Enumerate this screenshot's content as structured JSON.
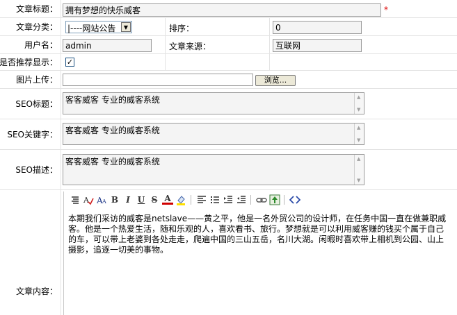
{
  "title_row": {
    "label": "文章标题：",
    "value": "拥有梦想的快乐威客",
    "required_mark": "*"
  },
  "category_row": {
    "label": "文章分类：",
    "selected": "|----网站公告",
    "sort_label": "排序：",
    "sort_value": "0"
  },
  "author_row": {
    "label": "用户名：",
    "value": "admin",
    "source_label": "文章来源：",
    "source_value": "互联网"
  },
  "recommend_row": {
    "label": "是否推荐显示：",
    "checked_mark": "✓"
  },
  "upload_row": {
    "label": "图片上传：",
    "browse_label": "浏览..."
  },
  "seo_title_row": {
    "label": "SEO标题：",
    "value": "客客威客 专业的威客系统"
  },
  "seo_keyword_row": {
    "label": "SEO关键字：",
    "value": "客客威客 专业的威客系统"
  },
  "seo_desc_row": {
    "label": "SEO描述：",
    "value": "客客威客 专业的威客系统"
  },
  "content_row": {
    "label": "文章内容：",
    "toolbar_icons": [
      "format-icon",
      "spellcheck-icon",
      "font-size-icon",
      "bold-icon",
      "italic-icon",
      "underline-icon",
      "strikethrough-icon",
      "font-color-icon",
      "highlight-icon",
      "align-left-icon",
      "ordered-list-icon",
      "indent-icon",
      "outdent-icon",
      "link-icon",
      "image-icon",
      "source-code-icon"
    ],
    "toolbar_glyphs": {
      "bold": "B",
      "italic": "I",
      "underline": "U",
      "strike": "S",
      "fontcolor": "A"
    },
    "body": "本期我们采访的威客是netslave——黄之平，他是一名外贸公司的设计师，在任务中国一直在做兼职威客。他是一个热爱生活，随和乐观的人，喜欢看书、旅行。梦想就是可以利用威客赚的钱买个属于自己的车，可以带上老婆到各处走走，爬遍中国的三山五岳，名川大湖。闲暇时喜欢带上相机到公园、山上摄影，追逐一切美的事物。"
  }
}
